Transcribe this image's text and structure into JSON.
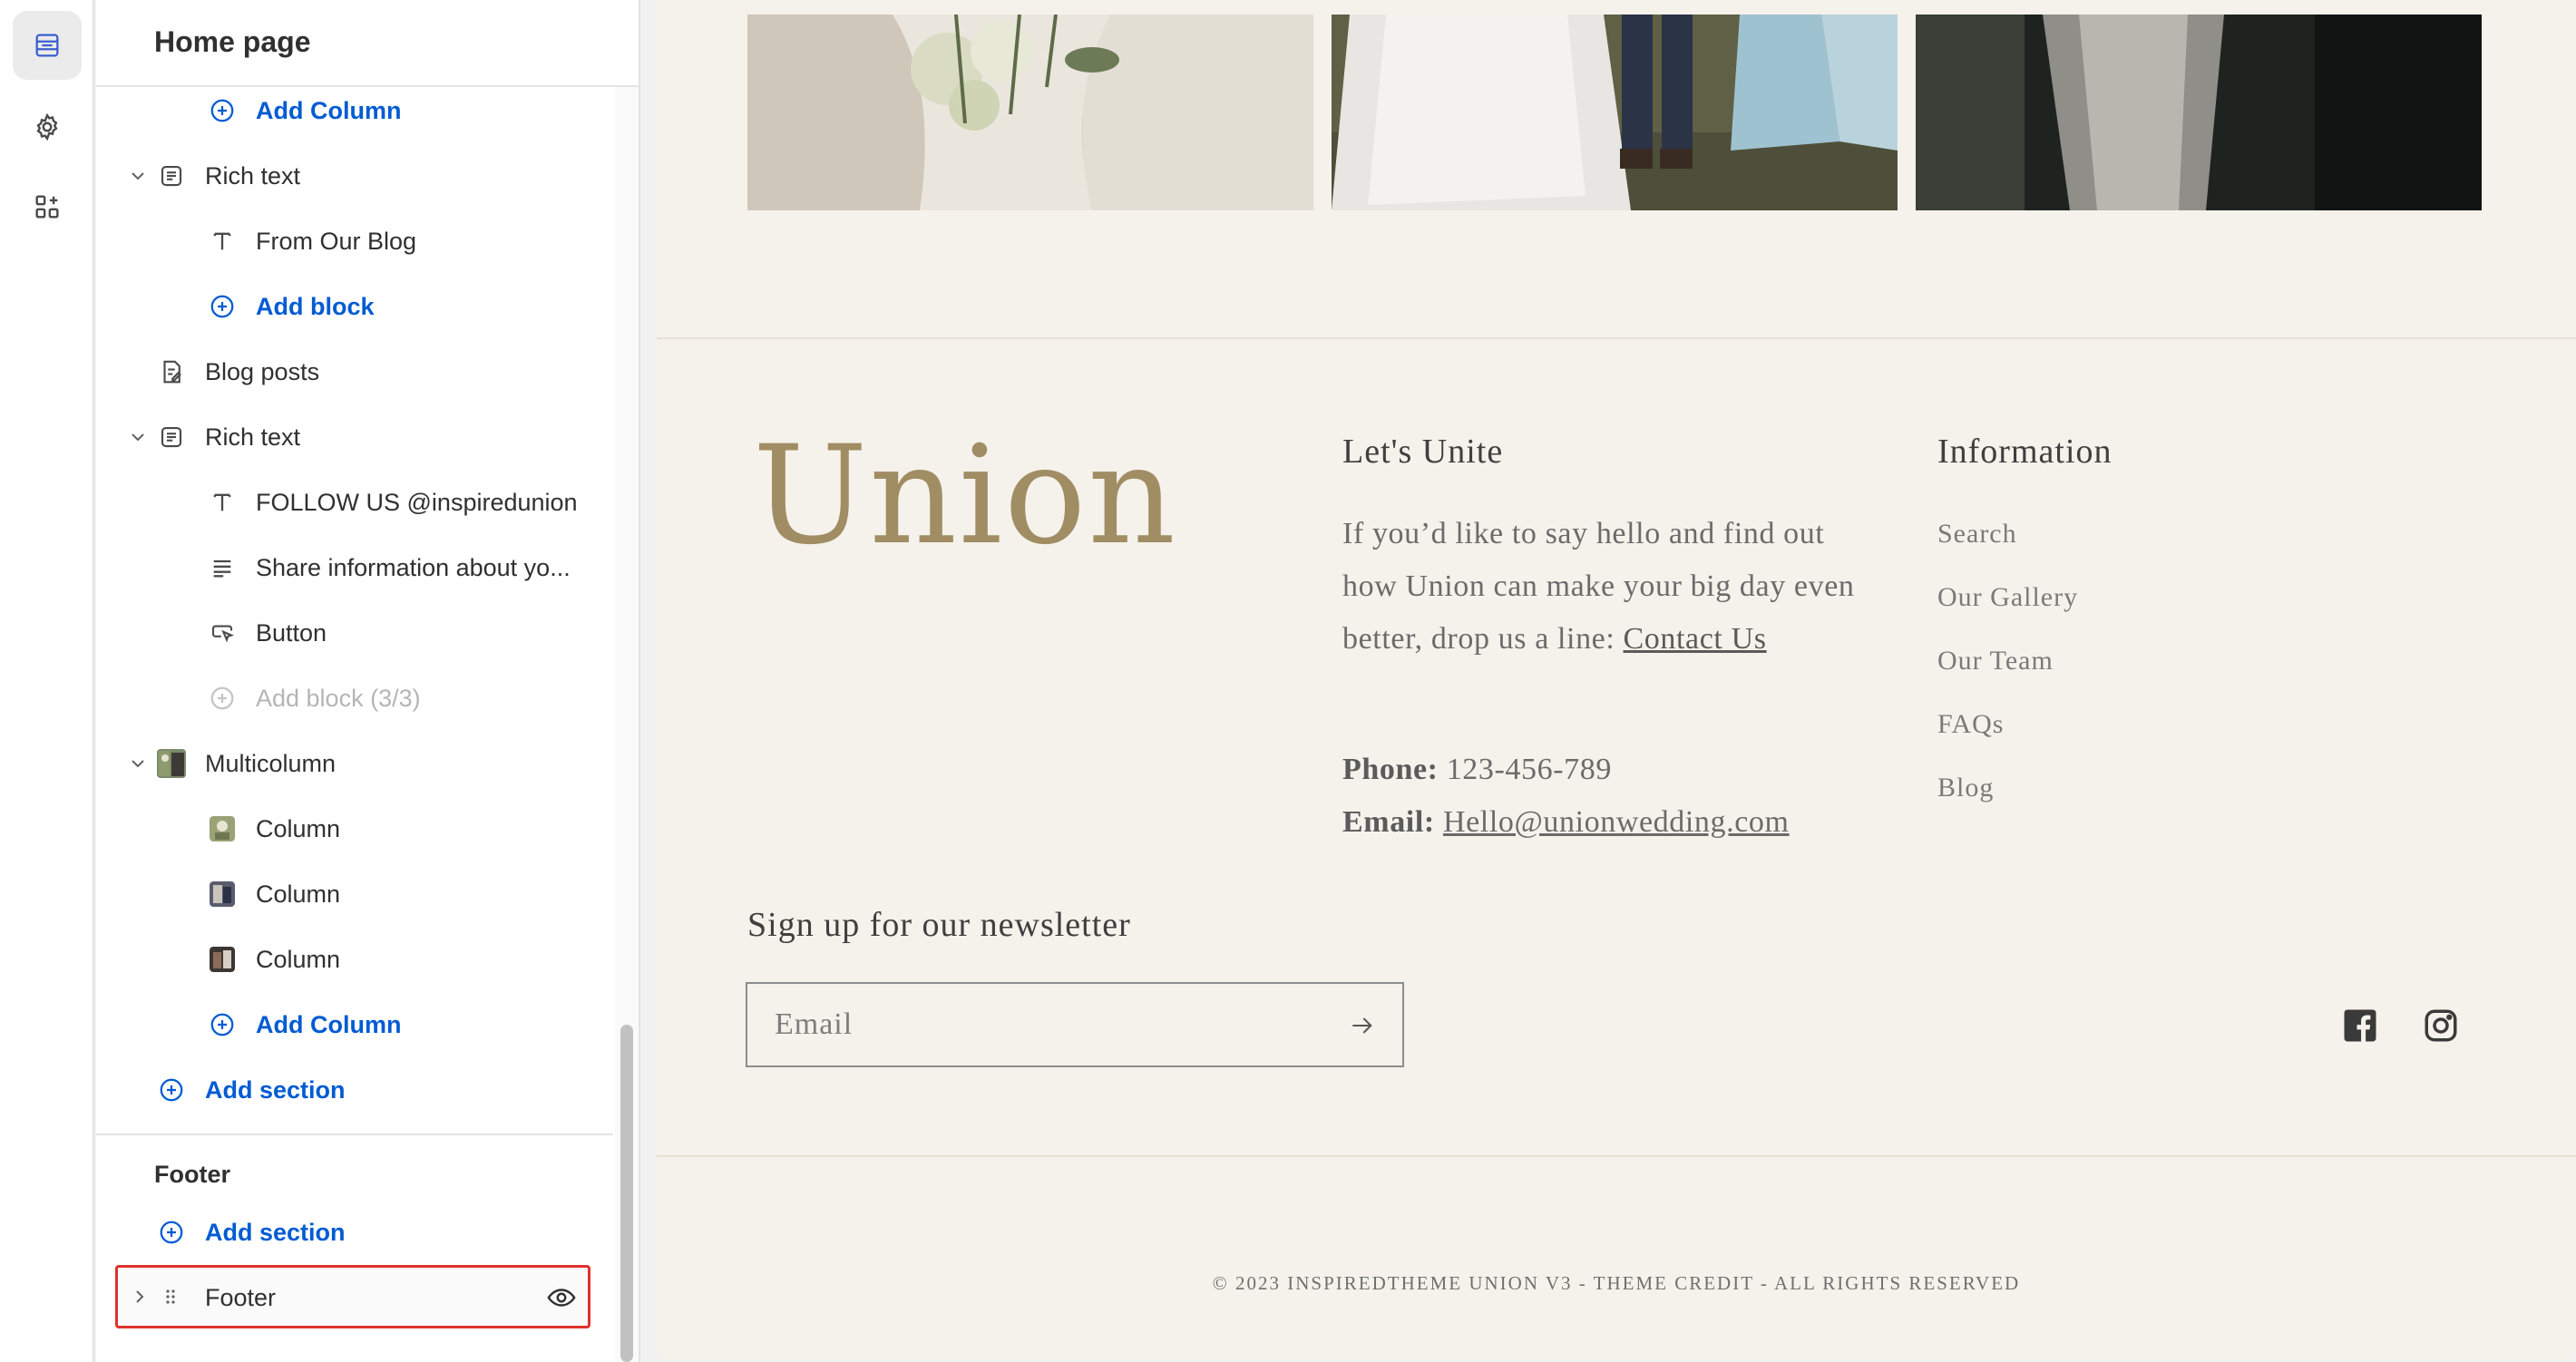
{
  "rail": {
    "items": [
      {
        "icon": "sections-icon",
        "active": true
      },
      {
        "icon": "gear-icon",
        "active": false
      },
      {
        "icon": "apps-add-icon",
        "active": false
      }
    ]
  },
  "sidebar": {
    "title": "Home page",
    "tree": {
      "add_column_1": "Add Column",
      "rich_text_1": "Rich text",
      "from_our_blog": "From Our Blog",
      "add_block_1": "Add block",
      "blog_posts": "Blog posts",
      "rich_text_2": "Rich text",
      "follow_us": "FOLLOW US @inspiredunion",
      "share_info": "Share information about yo...",
      "button": "Button",
      "add_block_disabled": "Add block (3/3)",
      "multicolumn": "Multicolumn",
      "column_1": "Column",
      "column_2": "Column",
      "column_3": "Column",
      "add_column_2": "Add Column",
      "add_section_1": "Add section"
    },
    "footer_group": {
      "heading": "Footer",
      "add_section": "Add section",
      "footer_item": "Footer"
    }
  },
  "preview": {
    "logo": "Union",
    "lets_unite": {
      "heading": "Let's Unite",
      "text": "If you’d like to say hello and find out how Union can make your big day even better, drop us a line: ",
      "link": "Contact Us",
      "phone_label": "Phone:",
      "phone_value": " 123-456-789",
      "email_label": "Email:",
      "email_value": "Hello@unionwedding.com"
    },
    "information": {
      "heading": "Information",
      "links": [
        "Search",
        "Our Gallery",
        "Our Team",
        "FAQs",
        "Blog"
      ]
    },
    "newsletter": {
      "heading": "Sign up for our newsletter",
      "placeholder": "Email"
    },
    "social": [
      "facebook-icon",
      "instagram-icon"
    ],
    "copyright": "© 2023 INSPIREDTHEME UNION V3 - THEME CREDIT - ALL RIGHTS RESERVED"
  },
  "colors": {
    "accent_blue": "#005bd3",
    "selection_red": "#e0312b",
    "preview_bg": "#f5f2eb",
    "logo_gold": "#a08d63"
  }
}
